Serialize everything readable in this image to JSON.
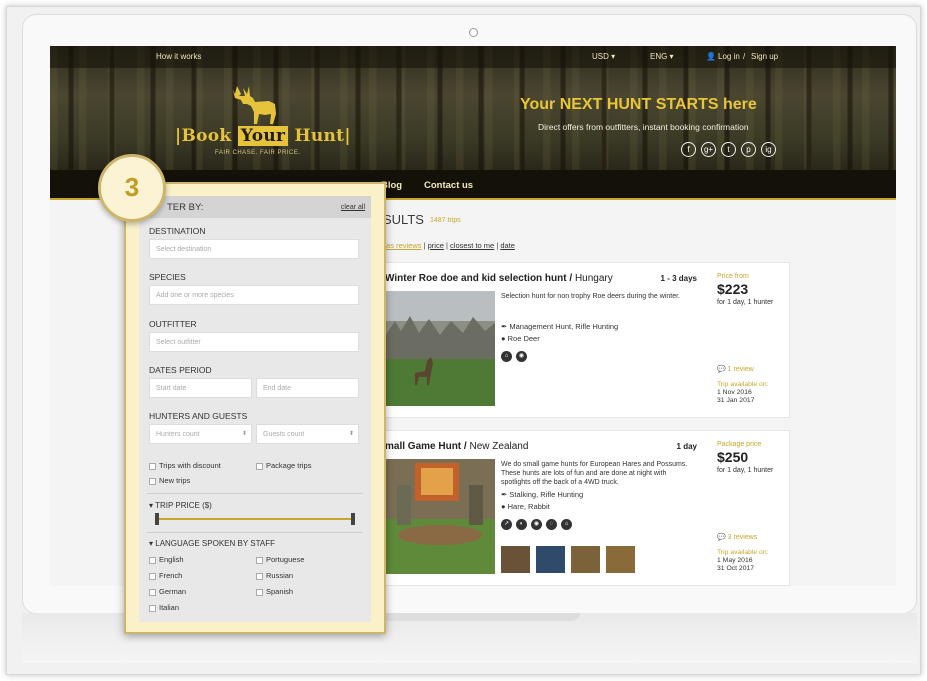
{
  "colors": {
    "accent": "#c9a62a",
    "nav_bg": "#141208",
    "filter_bg": "#e8e8e8",
    "badge_border": "#cdb56b"
  },
  "topbar": {
    "how_it_works": "How it works",
    "currency": "USD ▾",
    "language": "ENG ▾",
    "login": "Log in",
    "signup": "Sign up",
    "login_sep": "/"
  },
  "brand": {
    "left": "Book",
    "mid": "Your",
    "right": "Hunt",
    "tagline": "FAIR CHASE. FAIR PRICE."
  },
  "hero": {
    "headline": "Your NEXT HUNT STARTS here",
    "subline": "Direct offers from outfitters, instant booking confirmation"
  },
  "socials": [
    "f",
    "g+",
    "t",
    "p",
    "ig"
  ],
  "nav": {
    "blog": "Blog",
    "contact": "Contact us"
  },
  "step_badge": "3",
  "results": {
    "title": "SULTS",
    "count": "1487 trips"
  },
  "sort": {
    "prefix": "y",
    "items": [
      "has reviews",
      "price",
      "closest to me",
      "date"
    ],
    "sep": "|"
  },
  "listings": [
    {
      "title": "Winter Roe doe and kid selection hunt",
      "country": "Hungary",
      "duration": "1 - 3 days",
      "description": "Selection hunt for non trophy Roe deers during the winter.",
      "hunt_type": "Management Hunt, Rifle Hunting",
      "species": "Roe Deer",
      "price_label": "Price from",
      "price": "$223",
      "price_note": "for 1 day, 1 hunter",
      "reviews": "1 review",
      "avail_label": "Trip available on:",
      "avail_from": "1 Nov 2016",
      "avail_to": "31 Jan 2017"
    },
    {
      "title": "mall Game Hunt",
      "country": "New Zealand",
      "duration": "1 day",
      "description": "We do small game hunts for European Hares and Possums. These hunts are lots of fun and are done at night with spotlights off the back of a 4WD truck.",
      "hunt_type": "Stalking, Rifle Hunting",
      "species": "Hare, Rabbit",
      "price_label": "Package price",
      "price": "$250",
      "price_note": "for 1 day, 1 hunter",
      "reviews": "3 reviews",
      "avail_label": "Trip available on:",
      "avail_from": "1 May 2016",
      "avail_to": "31 Oct 2017"
    }
  ],
  "filter": {
    "header": "TER BY:",
    "clear": "clear all",
    "destination_label": "DESTINATION",
    "destination_placeholder": "Select destination",
    "species_label": "SPECIES",
    "species_placeholder": "Add one or more species",
    "outfitter_label": "OUTFITTER",
    "outfitter_placeholder": "Select outfitter",
    "dates_label": "DATES PERIOD",
    "start_placeholder": "Start date",
    "end_placeholder": "End date",
    "hunters_label": "HUNTERS AND GUESTS",
    "hunters_placeholder": "Hunters count",
    "guests_placeholder": "Guests count",
    "trips_discount": "Trips with discount",
    "package_trips": "Package trips",
    "new_trips": "New trips",
    "trip_price_label": "▾  TRIP PRICE ($)",
    "language_label": "▾  LANGUAGE SPOKEN BY STAFF",
    "languages": [
      "English",
      "Portuguese",
      "French",
      "Russian",
      "German",
      "Spanish",
      "Italian"
    ]
  }
}
